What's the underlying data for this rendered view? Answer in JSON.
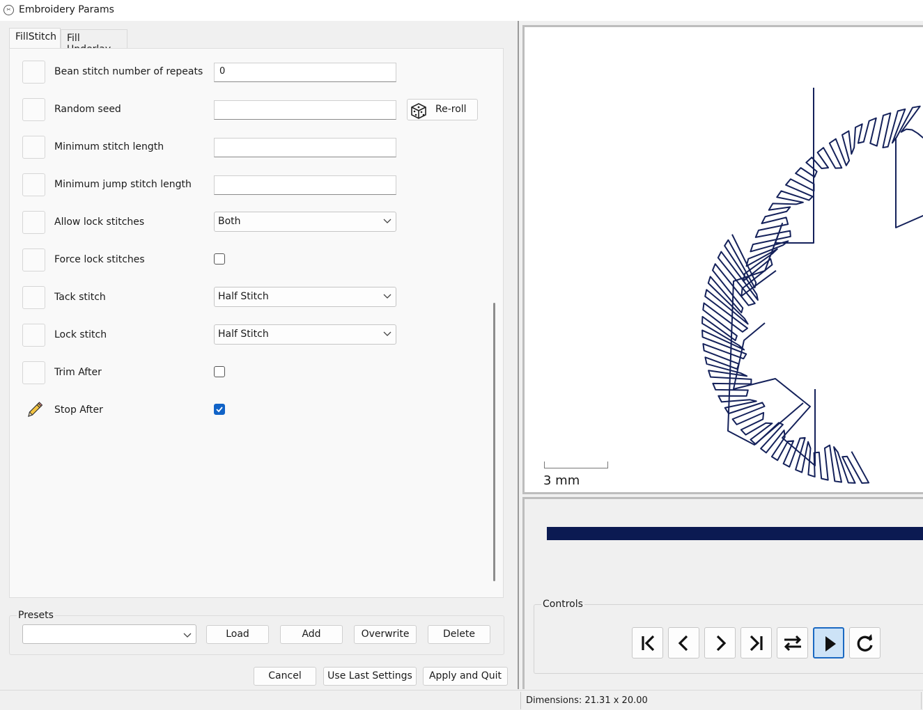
{
  "window": {
    "title": "Embroidery Params"
  },
  "tabs": [
    {
      "label": "FillStitch",
      "active": true
    },
    {
      "label": "Fill Underlay",
      "active": false
    }
  ],
  "params": {
    "bean_repeats": {
      "label": "Bean stitch number of repeats",
      "value": "0"
    },
    "random_seed": {
      "label": "Random seed",
      "value": "",
      "reroll_label": "Re-roll"
    },
    "min_stitch_length": {
      "label": "Minimum stitch length",
      "value": ""
    },
    "min_jump_length": {
      "label": "Minimum jump stitch length",
      "value": ""
    },
    "allow_lock": {
      "label": "Allow lock stitches",
      "value": "Both"
    },
    "force_lock": {
      "label": "Force lock stitches",
      "checked": false
    },
    "tack_stitch": {
      "label": "Tack stitch",
      "value": "Half Stitch"
    },
    "lock_stitch": {
      "label": "Lock stitch",
      "value": "Half Stitch"
    },
    "trim_after": {
      "label": "Trim After",
      "checked": false
    },
    "stop_after": {
      "label": "Stop After",
      "checked": true
    }
  },
  "presets": {
    "legend": "Presets",
    "selected": "",
    "load": "Load",
    "add": "Add",
    "overwrite": "Overwrite",
    "delete": "Delete"
  },
  "footer": {
    "cancel": "Cancel",
    "use_last": "Use Last Settings",
    "apply_quit": "Apply and Quit"
  },
  "preview": {
    "scale_label": "3 mm",
    "stitch_color": "#14215a",
    "progress_color": "#0b1a52",
    "progress": 1.0
  },
  "controls": {
    "legend": "Controls",
    "buttons": [
      {
        "name": "first-frame-icon"
      },
      {
        "name": "previous-frame-icon"
      },
      {
        "name": "next-frame-icon"
      },
      {
        "name": "last-frame-icon"
      },
      {
        "name": "swap-direction-icon"
      },
      {
        "name": "play-icon",
        "active": true
      },
      {
        "name": "restart-icon"
      }
    ]
  },
  "status": {
    "dimensions": "Dimensions: 21.31 x 20.00"
  }
}
